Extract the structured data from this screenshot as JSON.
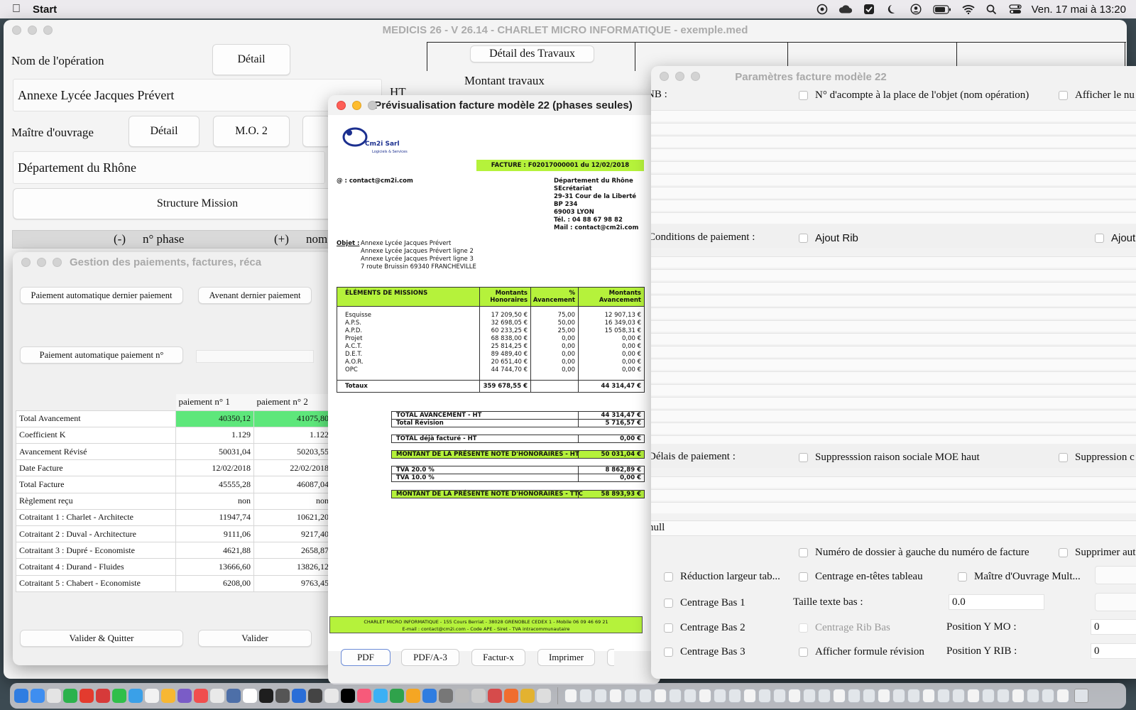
{
  "menubar": {
    "app_name": "Start",
    "datetime": "Ven. 17 mai à 13:20",
    "icons": [
      "apple-icon",
      "game-icon",
      "cloud-icon",
      "checkbox-icon",
      "moon-icon",
      "user-icon",
      "battery-icon",
      "wifi-icon",
      "search-icon",
      "control-center-icon"
    ]
  },
  "main": {
    "title": "MEDICIS 26  - V 26.14 - CHARLET MICRO INFORMATIQUE - exemple.med",
    "operation_label": "Nom de l'opération",
    "detail_label": "Détail",
    "operation_value": "Annexe Lycée Jacques Prévert",
    "ht_label": "HT",
    "mo_label": "Maître d'ouvrage",
    "mo_detail": "Détail",
    "mo2": "M.O. 2",
    "mo_value": "Département du Rhône",
    "structure": "Structure Mission",
    "phase_minus": "(-)",
    "phase_label": "n° phase",
    "phase_plus": "(+)",
    "phase_name": "nom",
    "works_detail": "Détail des Travaux",
    "works_amount": "Montant travaux"
  },
  "payments": {
    "title": "Gestion des paiements, factures, réca",
    "auto_last": "Paiement automatique dernier paiement",
    "amend_last": "Avenant dernier paiement",
    "auto_n": "Paiement automatique paiement n°",
    "col1": "paiement n° 1",
    "col2": "paiement n° 2",
    "rows": [
      {
        "label": "Total Avancement",
        "v1": "40350,12",
        "v2": "41075,80"
      },
      {
        "label": "Coefficient K",
        "v1": "1.129",
        "v2": "1.122"
      },
      {
        "label": "Avancement Révisé",
        "v1": "50031,04",
        "v2": "50203,55"
      },
      {
        "label": "Date Facture",
        "v1": "12/02/2018",
        "v2": "22/02/2018"
      },
      {
        "label": "Total Facture",
        "v1": "45555,28",
        "v2": "46087,04"
      },
      {
        "label": "Règlement reçu",
        "v1": "non",
        "v2": "non"
      },
      {
        "label": "Cotraitant 1 : Charlet - Architecte",
        "v1": "11947,74",
        "v2": "10621,20"
      },
      {
        "label": "Cotraitant 2 : Duval - Architecture",
        "v1": "9111,06",
        "v2": "9217,40"
      },
      {
        "label": "Cotraitant 3 : Dupré - Economiste",
        "v1": "4621,88",
        "v2": "2658,87"
      },
      {
        "label": "Cotraitant 4 : Durand - Fluides",
        "v1": "13666,60",
        "v2": "13826,12"
      },
      {
        "label": "Cotraitant 5 : Chabert - Economiste",
        "v1": "6208,00",
        "v2": "9763,45"
      }
    ],
    "validate_quit": "Valider & Quitter",
    "validate": "Valider",
    "colors": {
      "highlight": "#5ee77b"
    }
  },
  "preview": {
    "title": "Prévisualisation facture modèle 22 (phases seules)",
    "logo_name": "Cm2i Sarl",
    "logo_sub": "Logiciels & Services",
    "invoice_title": "FACTURE : F02017000001 du 12/02/2018",
    "contact": "@ : contact@cm2i.com",
    "recipient": [
      "Département du Rhône",
      "SEcrétariat",
      "29-31 Cour de la Liberté",
      "BP 234",
      "69003 LYON",
      "Tél. : 04 88 67 98 82",
      "Mail : contact@cm2i.com"
    ],
    "objet_label": "Objet :",
    "objet": [
      "Annexe Lycée Jacques Prévert",
      "Annexe Lycée Jacques Prévert ligne 2",
      "Annexe Lycée Jacques Prévert ligne 3",
      "7 route Bruissin 69340 FRANCHEVILLE"
    ],
    "headers": {
      "c1": "ÉLÉMENTS DE MISSIONS",
      "c2a": "Montants",
      "c2b": "Honoraires",
      "c3a": "%",
      "c3b": "Avancement",
      "c4a": "Montants",
      "c4b": "Avancement"
    },
    "phases": [
      {
        "name": "Esquisse",
        "fee": "17 209,50 €",
        "pct": "75,00",
        "amt": "12 907,13 €"
      },
      {
        "name": "A.P.S.",
        "fee": "32 698,05 €",
        "pct": "50,00",
        "amt": "16 349,03 €"
      },
      {
        "name": "A.P.D.",
        "fee": "60 233,25 €",
        "pct": "25,00",
        "amt": "15 058,31 €"
      },
      {
        "name": "Projet",
        "fee": "68 838,00 €",
        "pct": "0,00",
        "amt": "0,00 €"
      },
      {
        "name": "A.C.T.",
        "fee": "25 814,25 €",
        "pct": "0,00",
        "amt": "0,00 €"
      },
      {
        "name": "D.E.T.",
        "fee": "89 489,40 €",
        "pct": "0,00",
        "amt": "0,00 €"
      },
      {
        "name": "A.O.R.",
        "fee": "20 651,40 €",
        "pct": "0,00",
        "amt": "0,00 €"
      },
      {
        "name": "OPC",
        "fee": "44 744,70 €",
        "pct": "0,00",
        "amt": "0,00 €"
      }
    ],
    "totals_label": "Totaux",
    "totals_fee": "359 678,55 €",
    "totals_amt": "44 314,47 €",
    "sum": {
      "total_av_label": "TOTAL AVANCEMENT - HT",
      "total_av": "44 314,47 €",
      "revision_label": "Total Révision",
      "revision": "5 716,57 €",
      "billed_label": "TOTAL déjà facturé - HT",
      "billed": "0,00 €",
      "note_ht_label": "MONTANT DE LA PRÉSENTE NOTE D'HONORAIRES - HT",
      "note_ht": "50 031,04 €",
      "tva20_label": "TVA 20.0 %",
      "tva20": "8 862,89 €",
      "tva10_label": "TVA 10.0 %",
      "tva10": "0,00 €",
      "note_ttc_label": "MONTANT DE LA PRÉSENTE NOTE D'HONORAIRES - TTC",
      "note_ttc": "58 893,93 €"
    },
    "footer1": "CHARLET MICRO INFORMATIQUE - 155 Cours Berriat - 38028 GRENOBLE CEDEX 1 - Mobile 06 09 46 69 21",
    "footer2": "E-mail : contact@cm2i.com - Code APE  - Siret  - TVA intracommunautaire",
    "buttons": [
      "PDF",
      "PDF/A-3",
      "Factur-x",
      "Imprimer"
    ],
    "colors": {
      "green": "#b5f23b"
    }
  },
  "params": {
    "title": "Paramètres facture modèle 22",
    "nb_label": "NB :",
    "acompte": "N° d'acompte à la place de l'objet (nom opération)",
    "afficher": "Afficher le nu",
    "conditions": "Conditions de paiement :",
    "ajout_rib": "Ajout Rib",
    "ajout": "Ajout",
    "delais": "Délais de paiement :",
    "suppr_moe": "Suppresssion raison sociale MOE haut",
    "suppr": "Suppression c",
    "null_value": "null",
    "dossier": "Numéro de dossier à gauche du numéro de facture",
    "supprimer": "Supprimer aut",
    "reduction": "Réduction largeur tab...",
    "centrage_entetes": "Centrage en-têtes tableau",
    "mo_mult": "Maître d'Ouvrage Mult...",
    "cb1": "Centrage Bas 1",
    "taille_label": "Taille texte bas :",
    "taille_value": "0.0",
    "cb2": "Centrage Bas 2",
    "centrage_rib": "Centrage Rib Bas",
    "posmo_label": "Position Y MO :",
    "posmo_value": "0",
    "cb3": "Centrage Bas 3",
    "formule": "Afficher formule révision",
    "posrib_label": "Position Y RIB :",
    "posrib_value": "0"
  }
}
